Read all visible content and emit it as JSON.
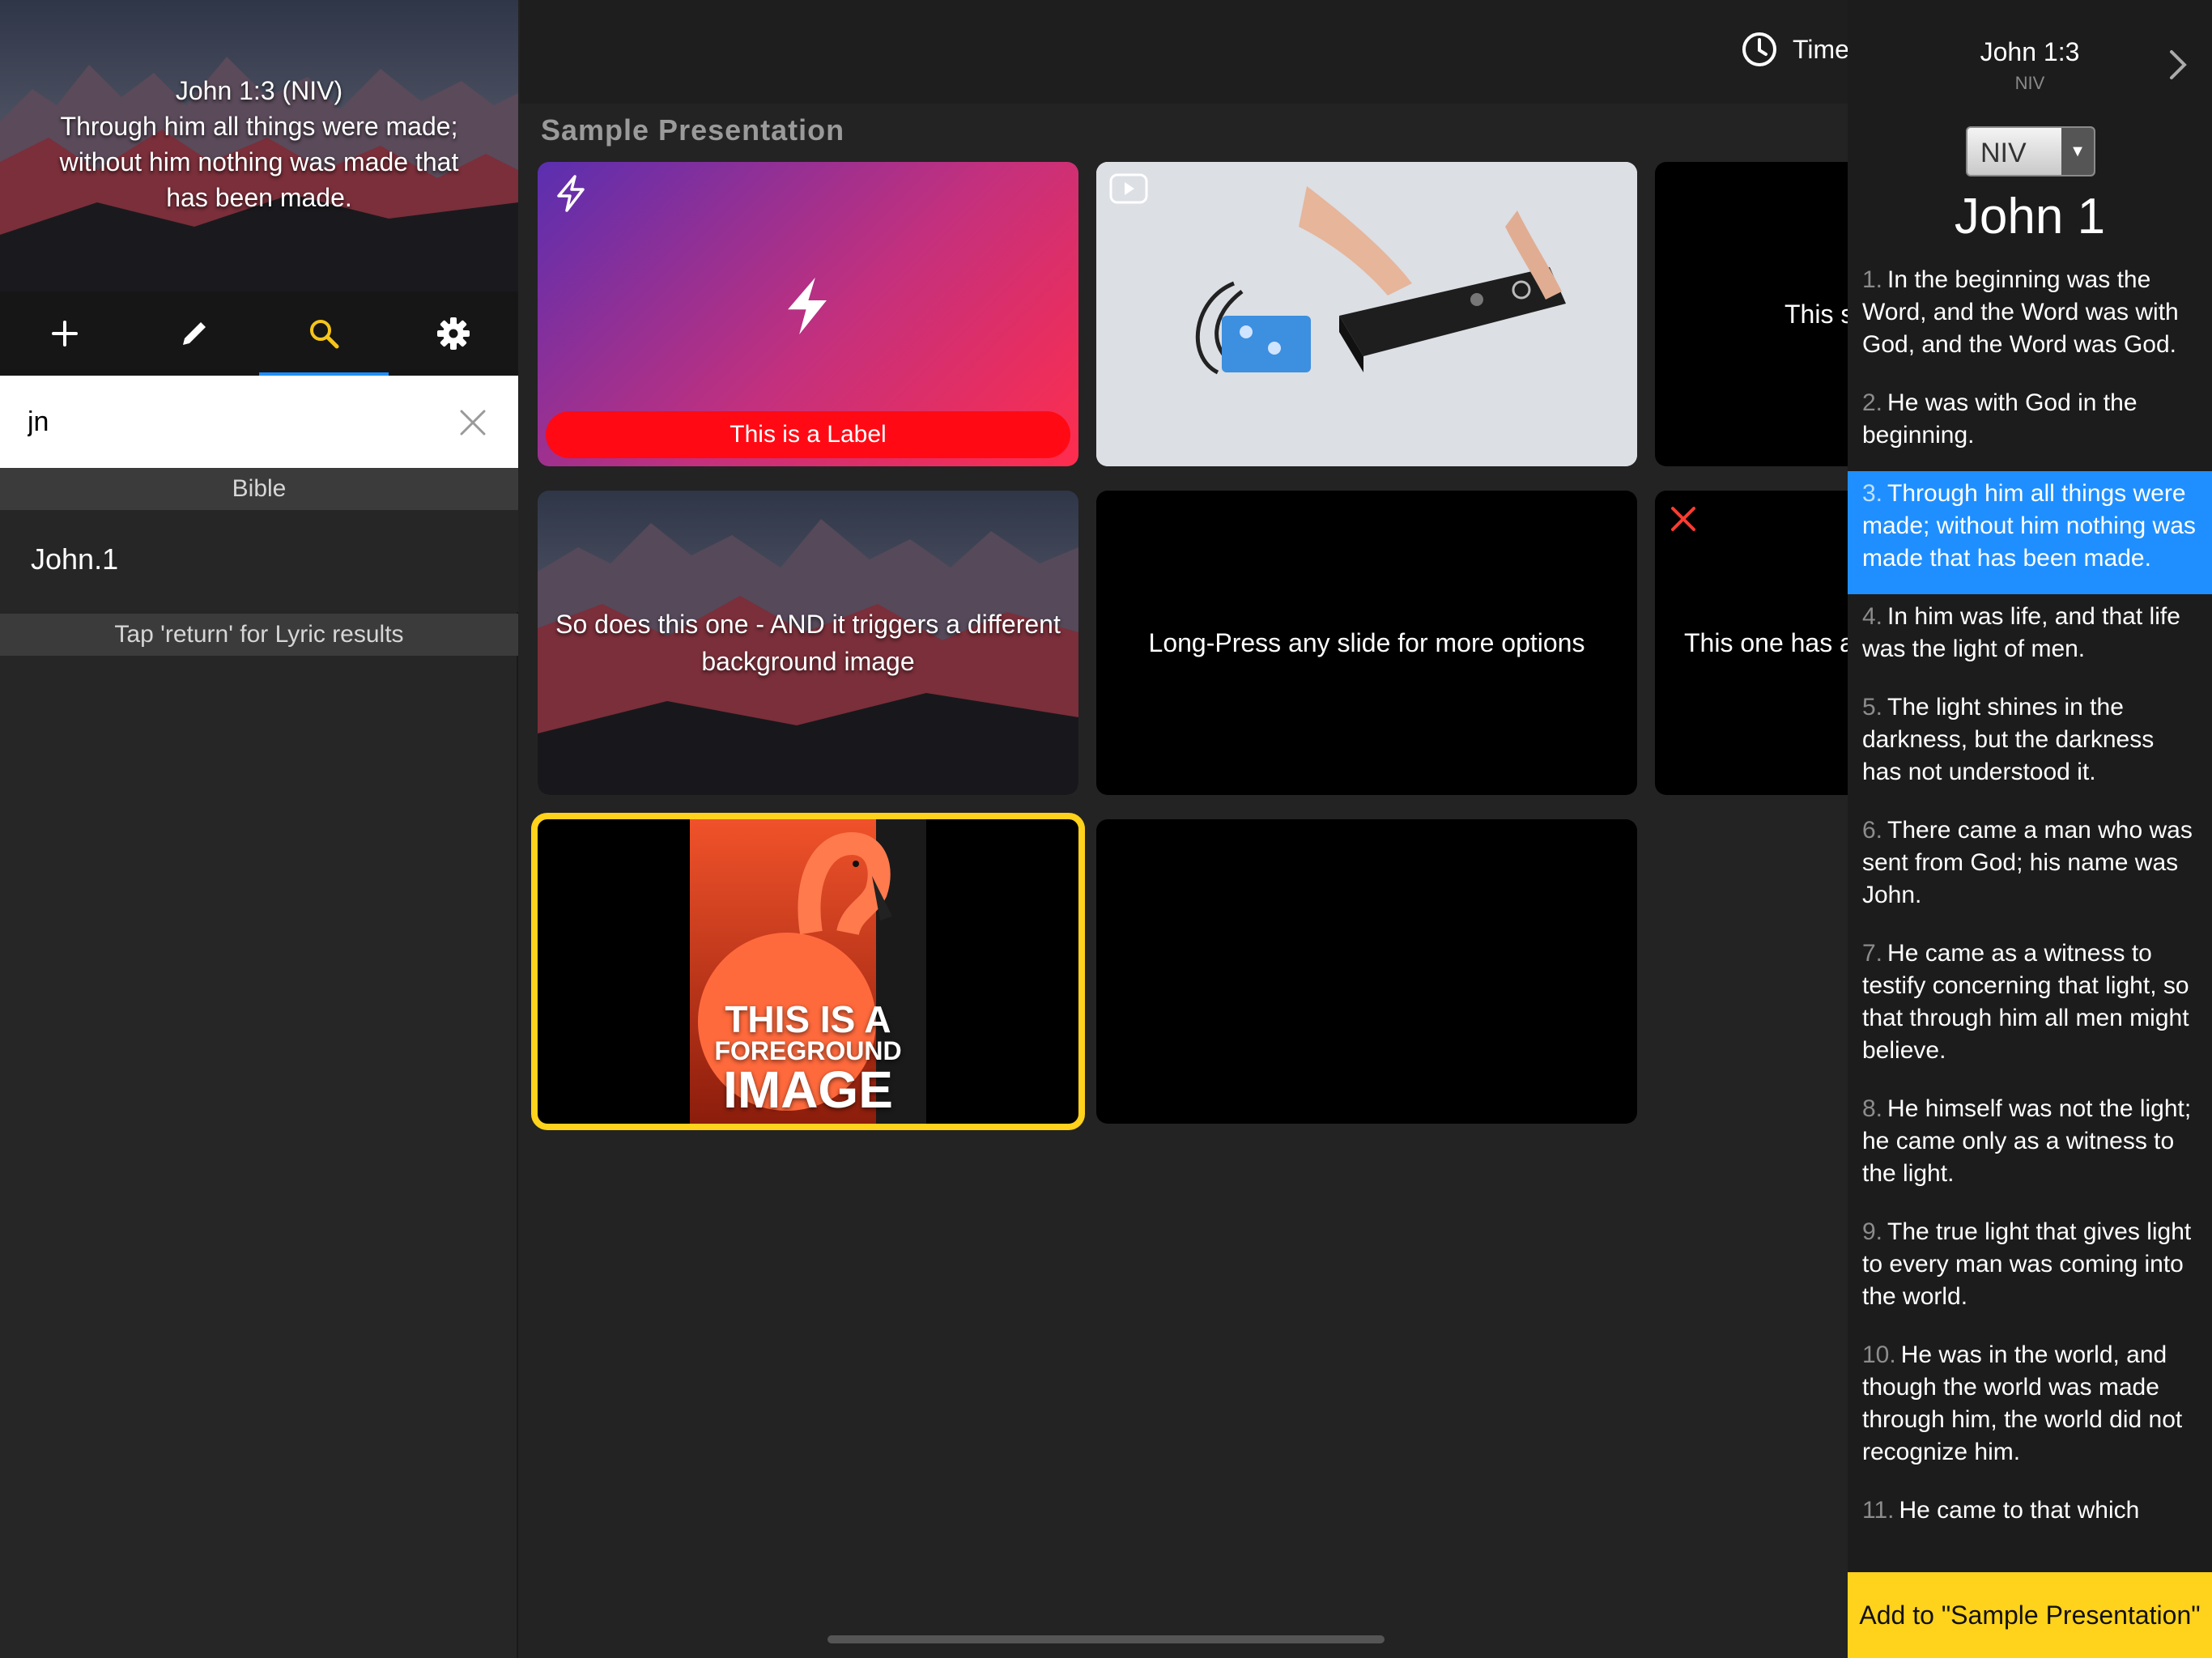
{
  "preview": {
    "text": "John 1:3 (NIV)\nThrough him all things were made;\nwithout him nothing was made that\nhas been made."
  },
  "toolbar": {
    "items": [
      {
        "name": "add",
        "icon": "plus-icon"
      },
      {
        "name": "edit",
        "icon": "pencil-icon"
      },
      {
        "name": "search",
        "icon": "search-icon",
        "active": true,
        "color": "#f5c51a"
      },
      {
        "name": "settings",
        "icon": "gear-icon"
      }
    ]
  },
  "search": {
    "value": "jn",
    "placeholder": ""
  },
  "results": {
    "section": "Bible",
    "items": [
      "John.1"
    ],
    "hint": "Tap 'return' for Lyric results"
  },
  "topbar": {
    "timer_label": "Time"
  },
  "presentation": {
    "title": "Sample Presentation",
    "slides": [
      {
        "type": "action",
        "label": "This is a Label"
      },
      {
        "type": "video"
      },
      {
        "type": "text",
        "text": "This s"
      },
      {
        "type": "text-background",
        "text": "So does this one - AND it triggers a different background image"
      },
      {
        "type": "text",
        "text": "Long-Press any slide for more options"
      },
      {
        "type": "text",
        "text": "This one has a"
      },
      {
        "type": "foreground-image",
        "image_text": [
          "THIS IS A",
          "FOREGROUND",
          "IMAGE"
        ],
        "selected": true
      },
      {
        "type": "blank"
      }
    ]
  },
  "bible_panel": {
    "reference": "John 1:3",
    "translation": "NIV",
    "version_select": "NIV",
    "chapter_title": "John 1",
    "selected_verse": 3,
    "verses": [
      {
        "n": "1.",
        "text": "In the beginning was the Word, and the Word was with God, and the Word was God."
      },
      {
        "n": "2.",
        "text": "He was with God in the beginning."
      },
      {
        "n": "3.",
        "text": "Through him all things were made; without him nothing was made that has been made."
      },
      {
        "n": "4.",
        "text": "In him was life, and that life was the light of men."
      },
      {
        "n": "5.",
        "text": "The light shines in the darkness, but the darkness has not understood it."
      },
      {
        "n": "6.",
        "text": "There came a man who was sent from God; his name was John."
      },
      {
        "n": "7.",
        "text": "He came as a witness to testify concerning that light, so that through him all men might believe."
      },
      {
        "n": "8.",
        "text": "He himself was not the light; he came only as a witness to the light."
      },
      {
        "n": "9.",
        "text": "The true light that gives light to every man was coming into the world."
      },
      {
        "n": "10.",
        "text": "He was in the world, and though the world was made through him, the world did not recognize him."
      },
      {
        "n": "11.",
        "text": "He came to that which"
      }
    ],
    "add_button": "Add to \"Sample Presentation\""
  },
  "colors": {
    "accent_blue": "#1f8fff",
    "accent_yellow": "#ffd21c",
    "label_red": "#ff0a14",
    "delete_red": "#ff3b30"
  }
}
